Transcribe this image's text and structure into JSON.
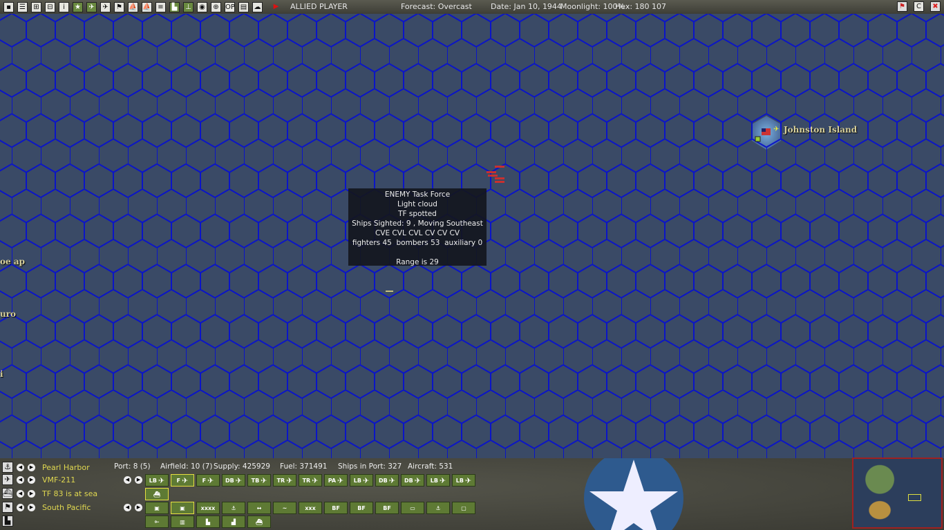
{
  "topbar": {
    "buttons": [
      "new",
      "report",
      "ships",
      "groups",
      "info",
      "star",
      "air-red",
      "air-blue",
      "flag",
      "ship",
      "ships2",
      "fleet",
      "land",
      "base",
      "globe",
      "target",
      "OP",
      "list",
      "weather",
      "end-turn"
    ],
    "side": "ALLIED PLAYER",
    "forecast": "Forecast: Overcast",
    "date": "Date: Jan 10, 1944",
    "moonlight": "Moonlight: 100%",
    "hex": "Hex: 180 107",
    "right_buttons": [
      "flag-toggle",
      "C",
      "close"
    ]
  },
  "map": {
    "locations": [
      {
        "name": "Johnston Island"
      },
      {
        "name": "oe ap"
      },
      {
        "name": "uro"
      },
      {
        "name": "i"
      }
    ],
    "tooltip": [
      "ENEMY Task Force",
      "Light cloud",
      "TF spotted",
      "Ships Sighted: 9 , Moving Southeast",
      "CVE CVL CVL CV CV CV",
      "fighters 45  bombers 53  auxiliary 0",
      "",
      "Range is 29"
    ]
  },
  "bottom": {
    "base": "Pearl Harbor",
    "port": "Port: 8 (5)",
    "airfield": "Airfield: 10 (7)",
    "supply": "Supply: 425929",
    "fuel": "Fuel: 371491",
    "ships_in_port": "Ships in Port: 327",
    "aircraft": "Aircraft: 531",
    "air_unit": "VMF-211",
    "tf": "TF 83 is at sea",
    "hq": "South Pacific",
    "air_buttons": [
      "LB",
      "F",
      "F",
      "DB",
      "TB",
      "TR",
      "TR",
      "PA",
      "LB",
      "DB",
      "DB",
      "LB",
      "LB"
    ],
    "hq_buttons": [
      "▣",
      "▣",
      "xxxx",
      "⚓",
      "↔",
      "~",
      "xxx",
      "BF",
      "BF",
      "BF",
      "▭",
      "⚓",
      "▢"
    ],
    "ind_buttons": [
      "⟜",
      "▥",
      "▙",
      "▟",
      "⛴"
    ]
  },
  "colors": {
    "sea": "#3a4a66",
    "grid": "#0a14c8",
    "label": "#e0d850"
  }
}
